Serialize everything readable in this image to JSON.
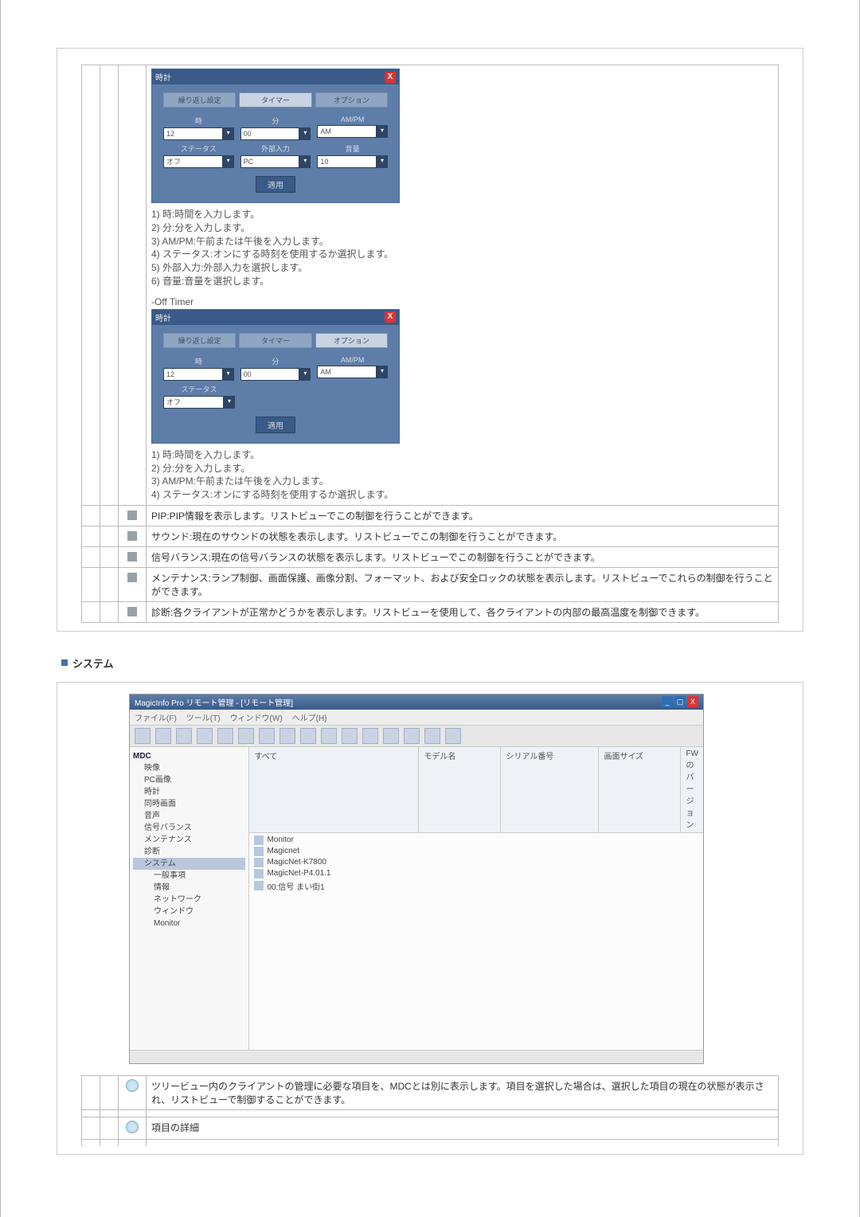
{
  "sectionTitle": "システム",
  "onTimer": {
    "title": "時計",
    "closeLabel": "X",
    "tabs": [
      "繰り返し設定",
      "タイマー",
      "オプション"
    ],
    "selectedTab": 1,
    "labels": {
      "hour": "時",
      "minute": "分",
      "ampm": "AM/PM"
    },
    "values": {
      "hour": "12",
      "minute": "00",
      "ampm": "AM"
    },
    "row2labels": {
      "status": "ステータス",
      "ext": "外部入力",
      "vol": "音量"
    },
    "row2values": {
      "status": "オフ",
      "ext": "PC",
      "vol": "10"
    },
    "applyLabel": "適用",
    "notes": [
      "1) 時:時間を入力します。",
      "2) 分:分を入力します。",
      "3) AM/PM:午前または午後を入力します。",
      "4) ステータス:オンにする時刻を使用するか選択します。",
      "5) 外部入力:外部入力を選択します。",
      "6) 音量:音量を選択します。"
    ]
  },
  "offTimerHeading": "-Off Timer",
  "offTimer": {
    "title": "時計",
    "closeLabel": "X",
    "tabs": [
      "繰り返し設定",
      "タイマー",
      "オプション"
    ],
    "selectedTab": 2,
    "labels": {
      "hour": "時",
      "minute": "分",
      "ampm": "AM/PM"
    },
    "values": {
      "hour": "12",
      "minute": "00",
      "ampm": "AM"
    },
    "row2labels": {
      "status": "ステータス"
    },
    "row2values": {
      "status": "オフ"
    },
    "applyLabel": "適用",
    "notes": [
      "1) 時:時間を入力します。",
      "2) 分:分を入力します。",
      "3) AM/PM:午前または午後を入力します。",
      "4) ステータス:オンにする時刻を使用するか選択します。"
    ]
  },
  "featureRows": [
    "PIP:PIP情報を表示します。リストビューでこの制御を行うことができます。",
    "サウンド:現在のサウンドの状態を表示します。リストビューでこの制御を行うことができます。",
    "信号バランス:現在の信号バランスの状態を表示します。リストビューでこの制御を行うことができます。",
    "メンテナンス:ランプ制御、画面保護、画像分割、フォーマット、および安全ロックの状態を表示します。リストビューでこれらの制御を行うことができます。",
    "診断:各クライアントが正常かどうかを表示します。リストビューを使用して、各クライアントの内部の最高温度を制御できます。"
  ],
  "sysShot": {
    "title": "MagicInfo Pro リモート管理 - [リモート管理]",
    "menus": [
      "ファイル(F)",
      "ツール(T)",
      "ウィンドウ(W)",
      "ヘルプ(H)"
    ],
    "tree": {
      "root": "MDC",
      "items": [
        "映像",
        "PC画像",
        "時計",
        "同時画面",
        "音声",
        "信号バランス",
        "メンテナンス"
      ],
      "sel": "診断",
      "group2Header": "システム",
      "group2": [
        "一般事項",
        "情報",
        "ネットワーク",
        "ウィンドウ",
        "Monitor"
      ]
    },
    "listCols": [
      "モデル名",
      "シリアル番号",
      "画面サイズ",
      "FWのバージョン"
    ],
    "listHeaderIcon": "すべて",
    "root": "Monitor",
    "rows": [
      "Magicnet",
      "MagicNet-K7800",
      "MagicNet-P4.01.1",
      "00:信号 まい街1"
    ]
  },
  "bottomRows": [
    "ツリービュー内のクライアントの管理に必要な項目を、MDCとは別に表示します。項目を選択した場合は、選択した項目の現在の状態が表示され、リストビューで制御することができます。",
    "項目の詳細"
  ]
}
